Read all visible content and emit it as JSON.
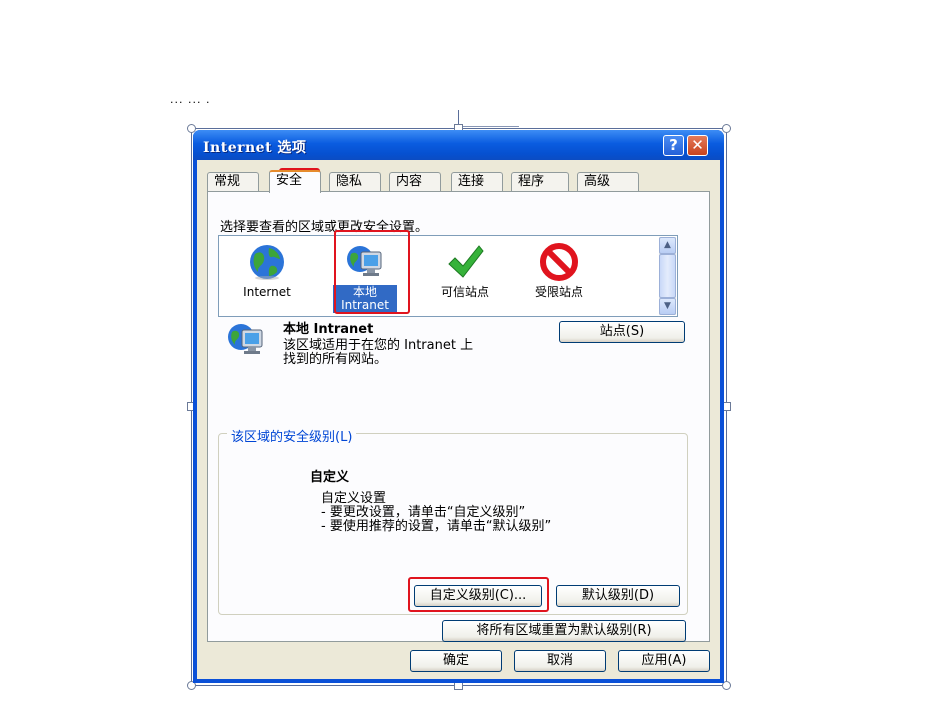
{
  "fragment_text": "··· ··· ·",
  "window": {
    "title": "Internet 选项",
    "help_button": "?",
    "close_button": "✕"
  },
  "tabs": [
    {
      "label": "常规",
      "active": false
    },
    {
      "label": "安全",
      "active": true
    },
    {
      "label": "隐私",
      "active": false
    },
    {
      "label": "内容",
      "active": false
    },
    {
      "label": "连接",
      "active": false
    },
    {
      "label": "程序",
      "active": false
    },
    {
      "label": "高级",
      "active": false
    }
  ],
  "security": {
    "instruction": "选择要查看的区域或更改安全设置。",
    "zones": [
      {
        "label": "Internet",
        "icon": "globe-icon"
      },
      {
        "label": "本地 Intranet",
        "icon": "local-intranet-icon",
        "selected": true
      },
      {
        "label": "可信站点",
        "icon": "checkmark-icon"
      },
      {
        "label": "受限站点",
        "icon": "restricted-icon"
      }
    ],
    "selected_zone": {
      "name": "本地 Intranet",
      "desc_line1": "该区域适用于在您的 Intranet 上",
      "desc_line2": "找到的所有网站。"
    },
    "sites_button": "站点(S)",
    "level_group_title": "该区域的安全级别(L)",
    "level_name": "自定义",
    "level_desc": [
      "自定义设置",
      "- 要更改设置，请单击“自定义级别”",
      "- 要使用推荐的设置，请单击“默认级别”"
    ],
    "custom_level_button": "自定义级别(C)...",
    "default_level_button": "默认级别(D)",
    "reset_all_button": "将所有区域重置为默认级别(R)"
  },
  "footer": {
    "ok": "确定",
    "cancel": "取消",
    "apply": "应用(A)"
  },
  "colors": {
    "title_bar": "#0a5ce0",
    "highlight": "#e0141e",
    "selection": "#316ac5"
  }
}
